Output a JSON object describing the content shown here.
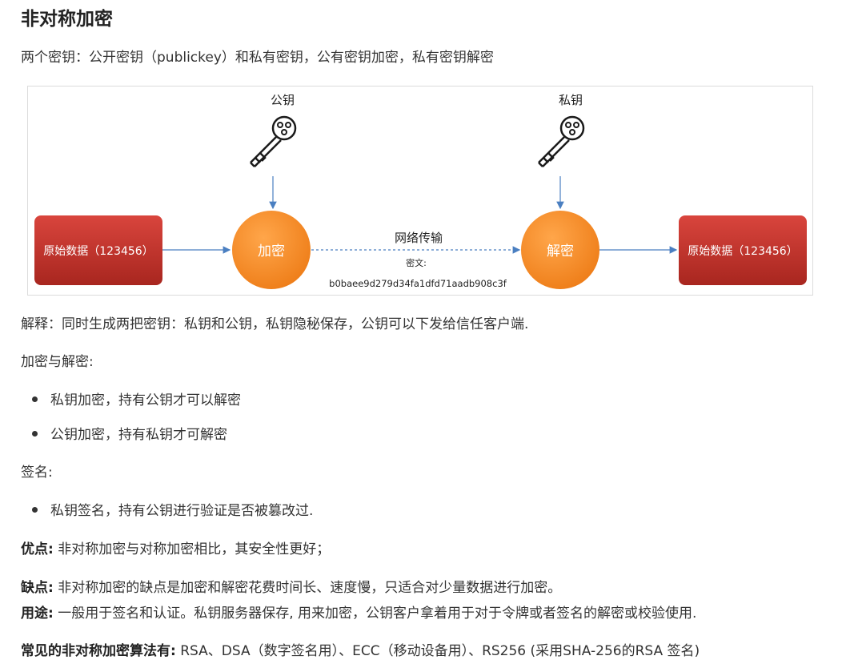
{
  "title": "非对称加密",
  "intro": "两个密钥：公开密钥（publickey）和私有密钥，公有密钥加密，私有密钥解密",
  "diagram": {
    "public_key_label": "公钥",
    "private_key_label": "私钥",
    "source_box": "原始数据（123456）",
    "encrypt_node": "加密",
    "network_label": "网络传输",
    "cipher_label": "密文:",
    "cipher_text": "b0baee9d279d34fa1dfd71aadb908c3f",
    "decrypt_node": "解密",
    "target_box": "原始数据（123456）",
    "colors": {
      "box_red": "#c0352f",
      "node_orange": "#f08a24",
      "arrow_blue": "#4a7fc1"
    }
  },
  "explain": "解释：同时生成两把密钥：私钥和公钥，私钥隐秘保存，公钥可以下发给信任客户端.",
  "enc_dec_heading": "加密与解密:",
  "enc_dec_items": [
    "私钥加密，持有公钥才可以解密",
    "公钥加密，持有私钥才可解密"
  ],
  "sign_heading": "签名:",
  "sign_items": [
    "私钥签名，持有公钥进行验证是否被篡改过."
  ],
  "pros": {
    "label": "优点:",
    "text": " 非对称加密与对称加密相比，其安全性更好；"
  },
  "cons": {
    "label": "缺点:",
    "text": " 非对称加密的缺点是加密和解密花费时间长、速度慢，只适合对少量数据进行加密。"
  },
  "usage": {
    "label": "用途:",
    "text": "  一般用于签名和认证。私钥服务器保存, 用来加密，公钥客户拿着用于对于令牌或者签名的解密或校验使用."
  },
  "algos": {
    "label": "常见的非对称加密算法有:",
    "text": "  RSA、DSA（数字签名用）、ECC（移动设备用）、RS256 (采用SHA-256的RSA 签名)"
  }
}
